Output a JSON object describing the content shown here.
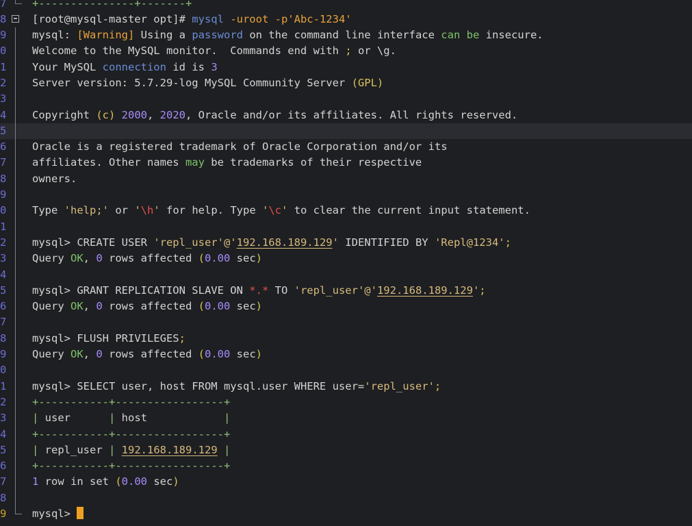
{
  "terminal": {
    "line_numbers": [
      "7",
      "8",
      "9",
      "0",
      "1",
      "2",
      "3",
      "4",
      "5",
      "6",
      "7",
      "8",
      "9",
      "0",
      "1",
      "2",
      "3",
      "4",
      "5",
      "6",
      "7",
      "8",
      "9",
      "0",
      "1",
      "2",
      "3",
      "4",
      "5",
      "6",
      "7",
      "8",
      "9"
    ],
    "top_border": "+---------------+-------+",
    "shell_prompt": "[root@mysql-master opt]# ",
    "command": "mysql",
    "command_args": "-uroot -p'Abc-1234'",
    "warning_prefix": "mysql: ",
    "warning_tag": "[Warning]",
    "warning_mid1": " Using a ",
    "warning_password": "password",
    "warning_mid2": " on the command line interface ",
    "warning_can": "can",
    "warning_space": " ",
    "warning_be": "be",
    "warning_end": " insecure.",
    "welcome": "Welcome to the MySQL monitor.  Commands end with ",
    "welcome_semi": ";",
    "welcome_end": " or \\g.",
    "conn_prefix": "Your MySQL ",
    "conn_word": "connection",
    "conn_mid": " id is ",
    "conn_id": "3",
    "server_prefix": "Server version: 5.7.29-log MySQL Community Server ",
    "server_paren": "(GPL)",
    "copyright_prefix": "Copyright ",
    "copyright_c": "(c)",
    "copyright_space": " ",
    "copyright_y1": "2000",
    "copyright_comma": ", ",
    "copyright_y2": "2020",
    "copyright_end": ", Oracle and/or its affiliates. All rights reserved.",
    "oracle1": "Oracle is a registered trademark of Oracle Corporation and/or its",
    "oracle2_a": "affiliates. Other names ",
    "oracle2_may": "may",
    "oracle2_b": " be trademarks of their respective",
    "oracle3": "owners.",
    "type_a": "Type ",
    "type_help": "'help;'",
    "type_or": " or ",
    "type_q1": "'",
    "type_h": "\\h",
    "type_q2": "'",
    "type_mid": " for help. Type ",
    "type_q3": "'",
    "type_c": "\\c",
    "type_q4": "'",
    "type_end": " to clear the current input statement.",
    "mysql_prompt": "mysql> ",
    "cmd1_a": "CREATE USER ",
    "cmd1_user": "'repl_user'",
    "cmd1_at": "@'",
    "cmd1_ip": "192.168.189.129",
    "cmd1_q": "'",
    "cmd1_b": " IDENTIFIED BY ",
    "cmd1_pw": "'Repl@1234'",
    "cmd1_semi": ";",
    "query_prefix": "Query ",
    "query_ok": "OK",
    "query_comma": ", ",
    "query_zero": "0",
    "query_mid": " rows affected ",
    "query_paren_open": "(",
    "query_time": "0.00",
    "query_sec": " sec",
    "query_paren_close": ")",
    "cmd2_a": "GRANT REPLICATION SLAVE ON ",
    "cmd2_star": "*.*",
    "cmd2_to": " TO ",
    "cmd2_user": "'repl_user'",
    "cmd2_at": "@'",
    "cmd2_ip": "192.168.189.129",
    "cmd2_q": "'",
    "cmd2_semi": ";",
    "cmd3": "FLUSH PRIVILEGES",
    "cmd3_semi": ";",
    "cmd4_a": "SELECT user, host FROM mysql.user WHERE user=",
    "cmd4_val": "'repl_user'",
    "cmd4_semi": ";",
    "table_border": "+-----------+-----------------+",
    "table_header_bar1": "| ",
    "table_header_user": "user      ",
    "table_header_bar2": "| ",
    "table_header_host": "host            ",
    "table_header_bar3": "|",
    "table_row_bar1": "| ",
    "table_row_user": "repl_user ",
    "table_row_bar2": "| ",
    "table_row_host": "192.168.189.129",
    "table_row_space": " ",
    "table_row_bar3": "|",
    "rowset_one": "1",
    "rowset_mid": " row in set ",
    "rowset_open": "(",
    "rowset_time": "0.00",
    "rowset_sec": " sec",
    "rowset_close": ")",
    "final_prompt": "mysql> "
  },
  "colors": {
    "background": "#1e1f22",
    "text": "#d4d4d4",
    "line_number": "#6b6fd6",
    "current_line_number": "#c9a227",
    "cursor": "#f0a020"
  }
}
